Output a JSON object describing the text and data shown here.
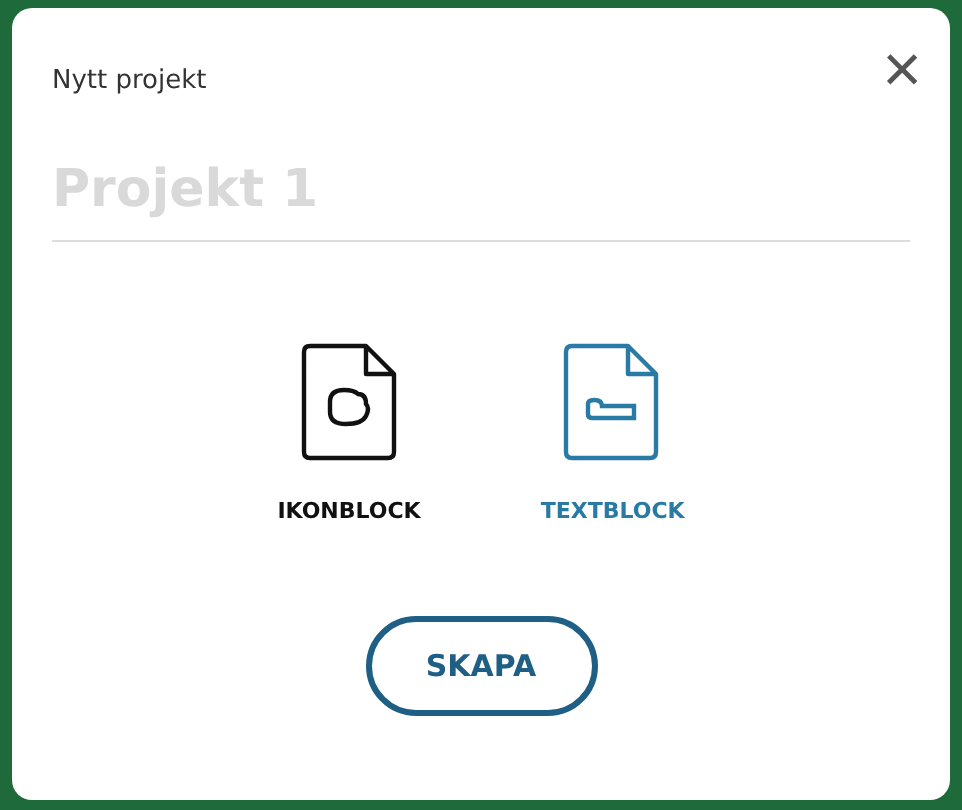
{
  "dialog": {
    "title": "Nytt projekt",
    "close": "×"
  },
  "name_field": {
    "placeholder": "Projekt 1"
  },
  "options": [
    {
      "label": "IKONBLOCK",
      "kind": "icon",
      "selected": false
    },
    {
      "label": "TEXTBLOCK",
      "kind": "text",
      "selected": true
    }
  ],
  "buttons": [
    "SKAPA"
  ]
}
